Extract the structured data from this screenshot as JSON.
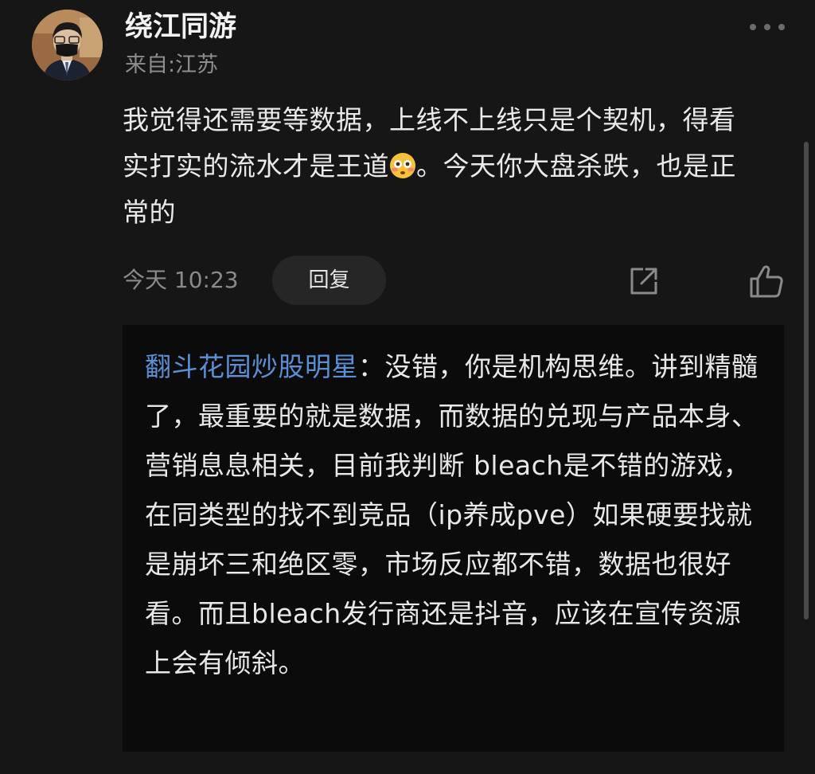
{
  "comment": {
    "username": "绕江同游",
    "location": "来自:江苏",
    "text_part1": "我觉得还需要等数据，上线不上线只是个契机，得看实打实的流水才是王道",
    "emoji": "flushed-face-emoji",
    "text_part2": "。今天你大盘杀跌，也是正常的",
    "timestamp": "今天 10:23",
    "reply_label": "回复"
  },
  "quoted_reply": {
    "author": "翻斗花园炒股明星",
    "separator": "：",
    "text": "没错，你是机构思维。讲到精髓了，最重要的就是数据，而数据的兑现与产品本身、营销息息相关，目前我判断 bleach是不错的游戏，在同类型的找不到竞品（ip养成pve）如果硬要找就是崩坏三和绝区零，市场反应都不错，数据也很好看。而且bleach发行商还是抖音，应该在宣传资源上会有倾斜。"
  },
  "icons": {
    "more": "more-dots-icon",
    "share": "share-icon",
    "like": "thumbs-up-icon"
  },
  "colors": {
    "background": "#161616",
    "quote_background": "#0b0b0b",
    "author_link": "#5b8fd6",
    "secondary_text": "#8e8e8e"
  }
}
